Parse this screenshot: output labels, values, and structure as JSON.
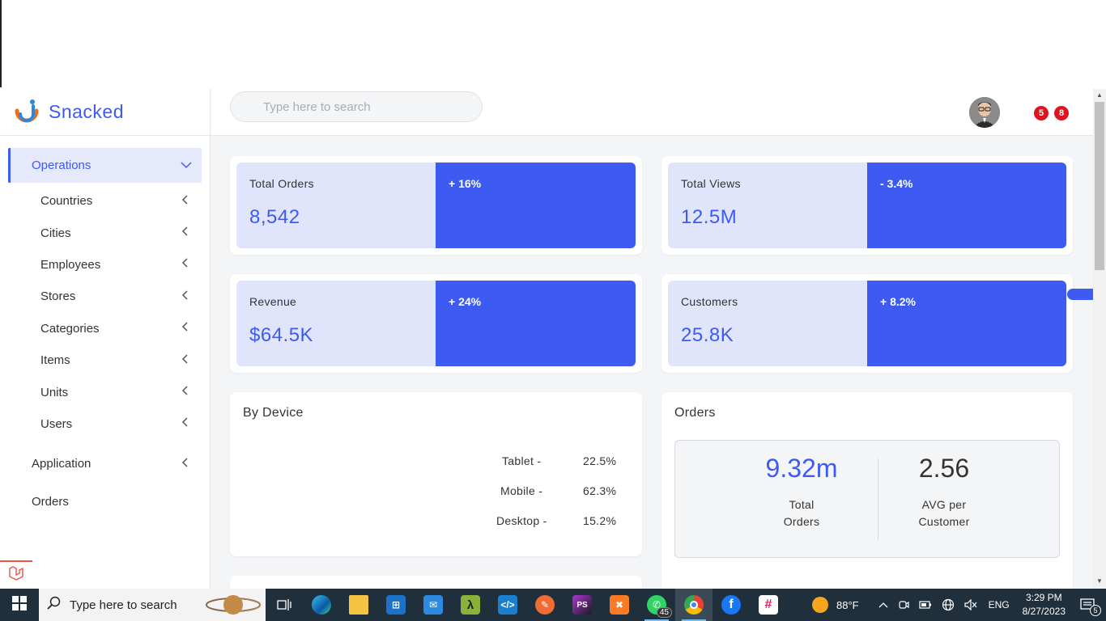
{
  "brand": {
    "name": "Snacked"
  },
  "search": {
    "placeholder": "Type here to search"
  },
  "header": {
    "notifications_count_1": "5",
    "notifications_count_2": "8"
  },
  "sidebar": {
    "operations_label": "Operations",
    "sub_items": [
      {
        "label": "Countries"
      },
      {
        "label": "Cities"
      },
      {
        "label": "Employees"
      },
      {
        "label": "Stores"
      },
      {
        "label": "Categories"
      },
      {
        "label": "Items"
      },
      {
        "label": "Units"
      },
      {
        "label": "Users"
      }
    ],
    "application_label": "Application",
    "orders_label": "Orders"
  },
  "stats": [
    {
      "label": "Total Orders",
      "value": "8,542",
      "change": "+ 16%"
    },
    {
      "label": "Total Views",
      "value": "12.5M",
      "change": "- 3.4%"
    },
    {
      "label": "Revenue",
      "value": "$64.5K",
      "change": "+ 24%"
    },
    {
      "label": "Customers",
      "value": "25.8K",
      "change": "+ 8.2%"
    }
  ],
  "by_device": {
    "title": "By Device",
    "rows": [
      {
        "label": "Tablet -",
        "value": "22.5%"
      },
      {
        "label": "Mobile -",
        "value": "62.3%"
      },
      {
        "label": "Desktop -",
        "value": "15.2%"
      }
    ]
  },
  "orders_panel": {
    "title": "Orders",
    "total_value": "9.32m",
    "total_label_1": "Total",
    "total_label_2": "Orders",
    "avg_value": "2.56",
    "avg_label_1": "AVG per",
    "avg_label_2": "Customer"
  },
  "colors": {
    "accent": "#3d5af1",
    "accent_light": "#e1e5fb",
    "badge": "#e0141e"
  },
  "taskbar": {
    "search_placeholder": "Type here to search",
    "weather": "88°F",
    "language": "ENG",
    "time": "3:29 PM",
    "date": "8/27/2023",
    "whatsapp_badge": "45",
    "notification_badge": "5",
    "apps": [
      "task-view-icon",
      "edge-icon",
      "file-explorer-icon",
      "store-icon",
      "mail-icon",
      "lambda-icon",
      "vscode-icon",
      "postman-icon",
      "phpstorm-icon",
      "xampp-icon",
      "whatsapp-icon",
      "chrome-icon",
      "facebook-icon",
      "slack-icon"
    ]
  }
}
